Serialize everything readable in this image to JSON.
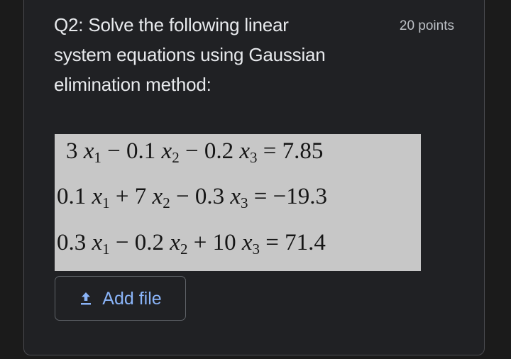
{
  "question": {
    "lines": [
      "Q2: Solve the following linear",
      "system equations using Gaussian",
      "elimination method:"
    ],
    "points": "20 points"
  },
  "equations": [
    {
      "terms": [
        {
          "coef": "3 ",
          "var": "x",
          "sub": "1"
        },
        {
          "op": " − ",
          "coef": "0.1 ",
          "var": "x",
          "sub": "2"
        },
        {
          "op": " − ",
          "coef": "0.2 ",
          "var": "x",
          "sub": "3"
        }
      ],
      "rhs": " = 7.85"
    },
    {
      "terms": [
        {
          "coef": "0.1 ",
          "var": "x",
          "sub": "1"
        },
        {
          "op": " + ",
          "coef": "7 ",
          "var": "x",
          "sub": "2"
        },
        {
          "op": " − ",
          "coef": "0.3 ",
          "var": "x",
          "sub": "3"
        }
      ],
      "rhs": " = −19.3"
    },
    {
      "terms": [
        {
          "coef": "0.3 ",
          "var": "x",
          "sub": "1"
        },
        {
          "op": " − ",
          "coef": "0.2 ",
          "var": "x",
          "sub": "2"
        },
        {
          "op": " + ",
          "coef": "10 ",
          "var": "x",
          "sub": "3"
        }
      ],
      "rhs": " = 71.4"
    }
  ],
  "add_file": {
    "label": "Add file",
    "icon": "upload-icon",
    "color": "#8ab4f8"
  },
  "colors": {
    "background": "#1b1b1b",
    "card": "#202124",
    "text": "#e8eaed",
    "image_background": "#c7c7c7"
  }
}
